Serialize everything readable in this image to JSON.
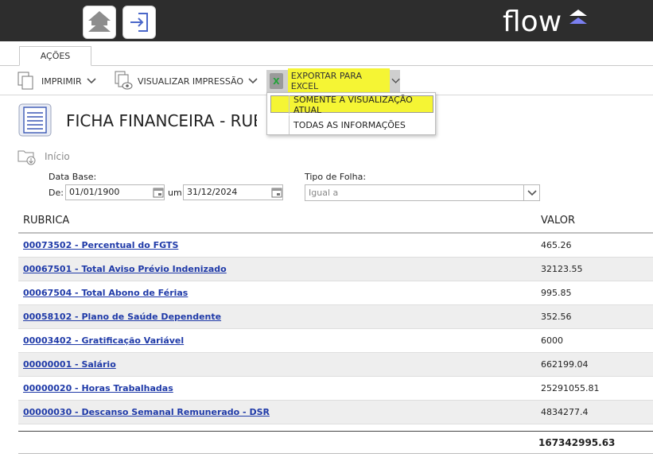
{
  "header": {
    "logo_text": "flow",
    "accent": "#7b7ff0",
    "icons": [
      "home-upload-icon",
      "exit-icon"
    ]
  },
  "tabs": [
    {
      "label": "AÇÕES"
    }
  ],
  "toolbar": {
    "print_label": "IMPRIMIR",
    "preview_label": "VISUALIZAR IMPRESSÃO",
    "export_label": "EXPORTAR PARA EXCEL",
    "highlight_color": "#f5f534"
  },
  "export_menu": {
    "items": [
      {
        "label": "SOMENTE A VISUALIZAÇÃO ATUAL",
        "highlighted": true
      },
      {
        "label": "TODAS AS INFORMAÇÕES",
        "highlighted": false
      }
    ]
  },
  "page": {
    "title": "FICHA FINANCEIRA - RUBRICA",
    "breadcrumb": "Início"
  },
  "filters": {
    "data_base_label": "Data Base:",
    "de_label": "De:",
    "de_value": "01/01/1900",
    "um_label": "um",
    "ate_value": "31/12/2024",
    "tipo_label": "Tipo de Folha:",
    "tipo_value": "Igual a"
  },
  "table": {
    "columns": [
      "RUBRICA",
      "VALOR"
    ],
    "rows": [
      {
        "rubrica": "00073502 - Percentual do FGTS",
        "valor": "465.26"
      },
      {
        "rubrica": "00067501 - Total Aviso Prévio Indenizado",
        "valor": "32123.55"
      },
      {
        "rubrica": "00067504 - Total Abono de Férias",
        "valor": "995.85"
      },
      {
        "rubrica": "00058102 - Plano de Saúde Dependente",
        "valor": "352.56"
      },
      {
        "rubrica": "00003402 - Gratificação Variável",
        "valor": "6000"
      },
      {
        "rubrica": "00000001 - Salário",
        "valor": "662199.04"
      },
      {
        "rubrica": "00000020 - Horas Trabalhadas",
        "valor": "25291055.81"
      },
      {
        "rubrica": "00000030 - Descanso Semanal Remunerado - DSR",
        "valor": "4834277.4"
      }
    ],
    "total": "167342995.63"
  }
}
